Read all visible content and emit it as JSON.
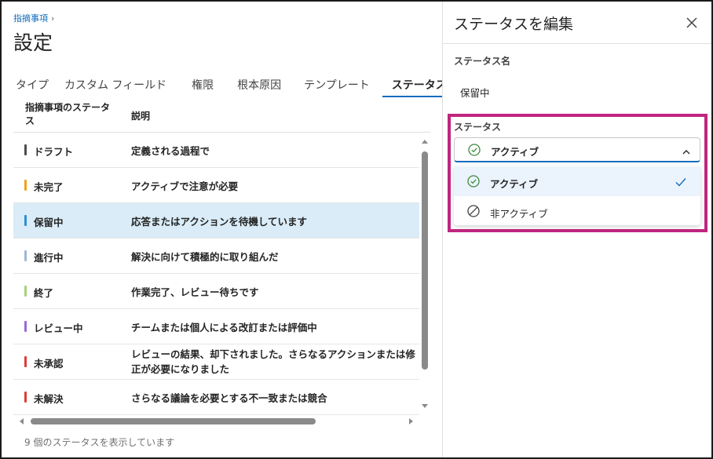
{
  "breadcrumb": {
    "link": "指摘事項"
  },
  "page": {
    "title": "設定"
  },
  "tabs": [
    {
      "label": "タイプ"
    },
    {
      "label": "カスタム フィールド"
    },
    {
      "label": "権限"
    },
    {
      "label": "根本原因"
    },
    {
      "label": "テンプレート"
    },
    {
      "label": "ステータス",
      "active": true
    }
  ],
  "table": {
    "headers": {
      "status": "指摘事項のステータス",
      "description": "説明"
    },
    "rows": [
      {
        "name": "ドラフト",
        "description": "定義される過程で",
        "color": "#4d4d4d"
      },
      {
        "name": "未完了",
        "description": "アクティブで注意が必要",
        "color": "#f0a21e"
      },
      {
        "name": "保留中",
        "description": "応答またはアクションを待機しています",
        "color": "#2d8fcf",
        "selected": true
      },
      {
        "name": "進行中",
        "description": "解決に向けて積極的に取り組んだ",
        "color": "#9fb7d6"
      },
      {
        "name": "終了",
        "description": "作業完了、レビュー待ちです",
        "color": "#a6d279"
      },
      {
        "name": "レビュー中",
        "description": "チームまたは個人による改訂または評価中",
        "color": "#9b6ad8"
      },
      {
        "name": "未承認",
        "description": "レビューの結果、却下されました。さらなるアクションまたは修正が必要になりました",
        "color": "#e03a3a"
      },
      {
        "name": "未解決",
        "description": "さらなる議論を必要とする不一致または競合",
        "color": "#e03a3a"
      }
    ]
  },
  "footer": {
    "count_text": "9 個のステータスを表示しています"
  },
  "panel": {
    "title": "ステータスを編集",
    "name_label": "ステータス名",
    "name_value": "保留中",
    "status_label": "ステータス",
    "selected_value": "アクティブ",
    "options": [
      {
        "label": "アクティブ",
        "icon": "check-circle-icon",
        "selected": true
      },
      {
        "label": "非アクティブ",
        "icon": "prohibited-icon",
        "selected": false
      }
    ]
  },
  "colors": {
    "accent": "#0f6cbd",
    "highlight": "#c0267f",
    "active_icon": "#3e8a3e"
  }
}
